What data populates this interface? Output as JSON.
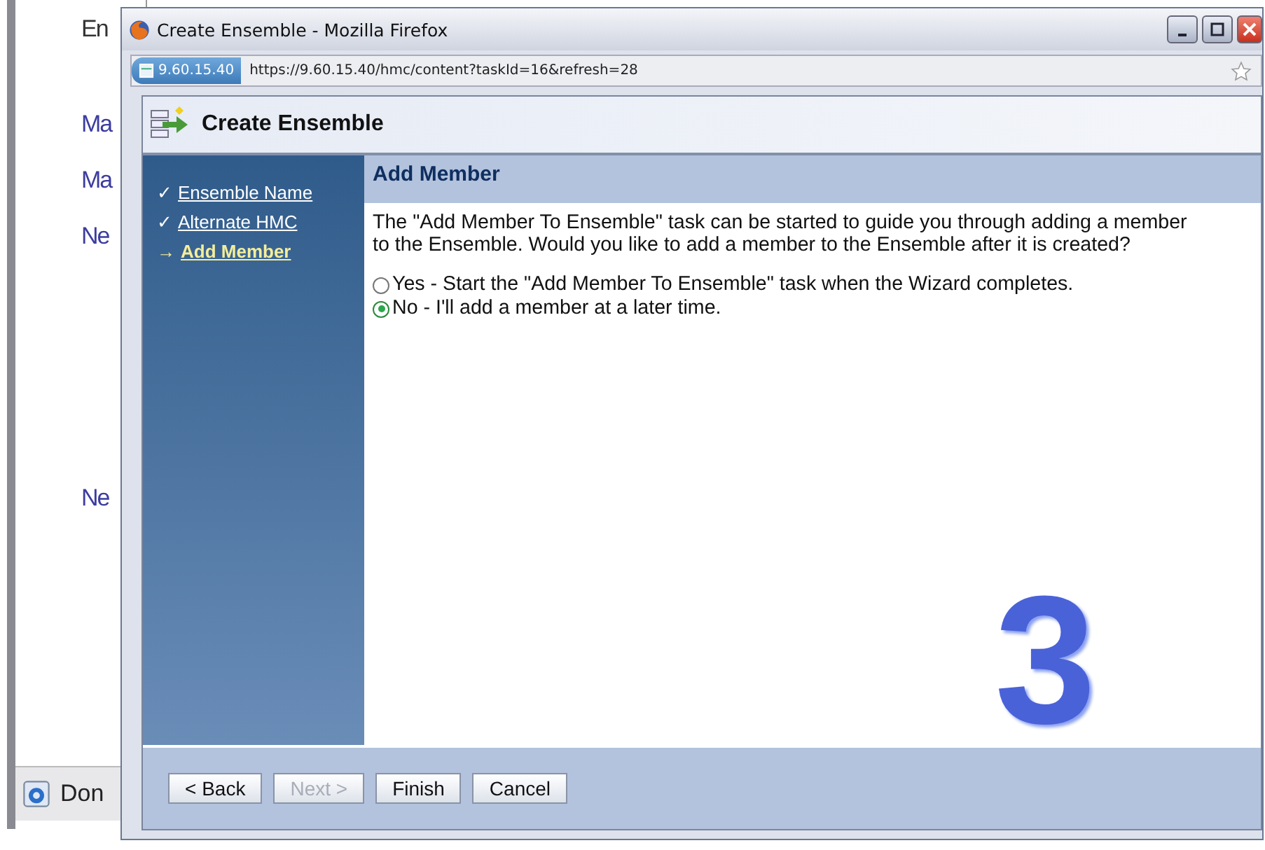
{
  "background_page": {
    "texts": [
      {
        "text": "En",
        "kind": "heading"
      },
      {
        "text": "Ma",
        "kind": "link"
      },
      {
        "text": "Ma",
        "kind": "link"
      },
      {
        "text": "Ne",
        "kind": "link"
      },
      {
        "text": "Ne",
        "kind": "link"
      }
    ],
    "status": "Don"
  },
  "window": {
    "title": "Create Ensemble - Mozilla Firefox",
    "site_badge": "9.60.15.40",
    "url": "https://9.60.15.40/hmc/content?taskId=16&refresh=28"
  },
  "wizard": {
    "title": "Create Ensemble",
    "steps": [
      {
        "label": "Ensemble Name",
        "marker": "✓",
        "selected": false
      },
      {
        "label": "Alternate HMC",
        "marker": "✓",
        "selected": false
      },
      {
        "label": "Add Member",
        "marker": "→",
        "selected": true
      }
    ],
    "page_title": "Add Member",
    "description": "The \"Add Member To Ensemble\" task can be started to guide you through adding a member to the Ensemble. Would you like to add a member to the Ensemble after it is created?",
    "options": [
      {
        "label": "Yes - Start the \"Add Member To Ensemble\" task when the Wizard completes.",
        "selected": false
      },
      {
        "label": "No - I'll add a member at a later time.",
        "selected": true
      }
    ],
    "buttons": [
      {
        "label": "< Back",
        "disabled": false
      },
      {
        "label": "Next >",
        "disabled": true
      },
      {
        "label": "Finish",
        "disabled": false
      },
      {
        "label": "Cancel",
        "disabled": false
      }
    ]
  },
  "overlay_number": "3"
}
